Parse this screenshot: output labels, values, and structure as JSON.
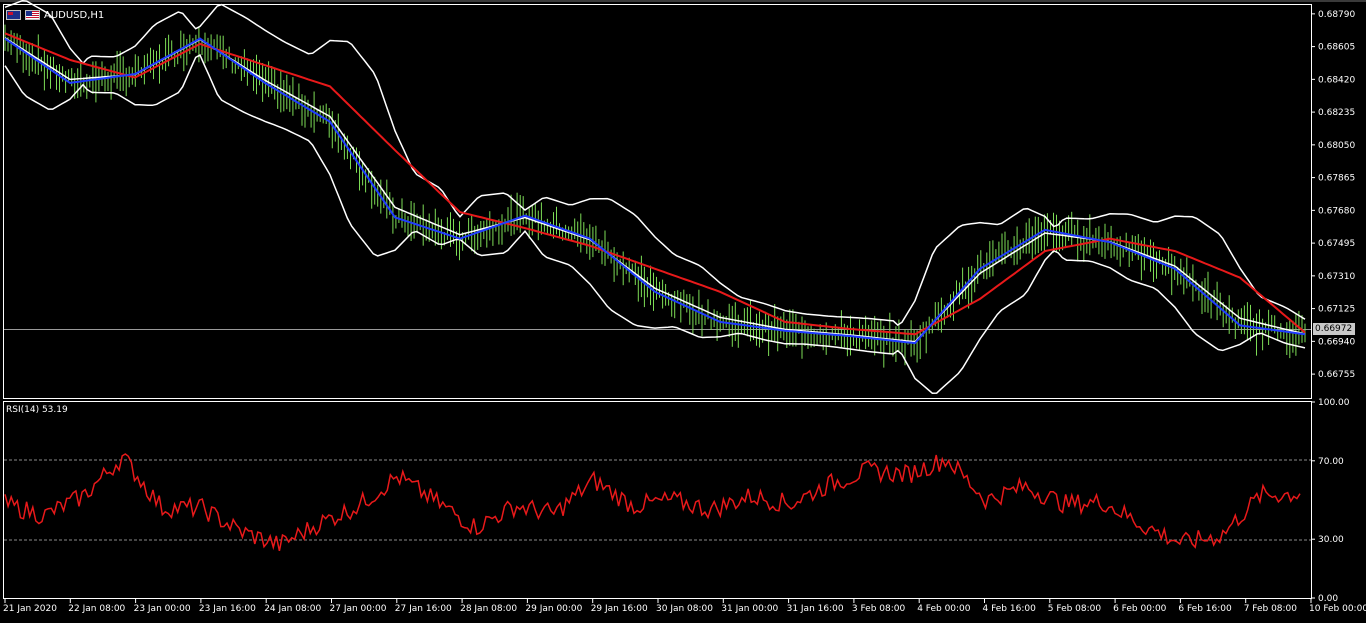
{
  "window": {
    "title": "AUDUSD,H1",
    "flag_left_icon": "au-flag-icon",
    "flag_right_icon": "us-flag-icon"
  },
  "colors": {
    "background": "#000000",
    "candle": "#7ddc56",
    "ma_fast": "#1f3cff",
    "ma_slow": "#e8191a",
    "bands": "#ffffff",
    "rsi_line": "#e8191a",
    "grid_level": "#8a8a8a",
    "price_line": "#9a9a9a",
    "price_tag_bg": "#c8c8c8"
  },
  "price_axis": {
    "labels": [
      "0.68790",
      "0.68605",
      "0.68420",
      "0.68235",
      "0.68050",
      "0.67865",
      "0.67680",
      "0.67495",
      "0.67310",
      "0.67125",
      "0.66940",
      "0.66755"
    ],
    "current_price": "0.66972"
  },
  "rsi_panel": {
    "label": "RSI(14) 53.19",
    "axis_labels": [
      "100.00",
      "70.00",
      "30.00",
      "0.00"
    ],
    "levels": [
      70,
      30
    ]
  },
  "time_axis": {
    "labels": [
      "21 Jan 2020",
      "22 Jan 08:00",
      "23 Jan 00:00",
      "23 Jan 16:00",
      "24 Jan 08:00",
      "27 Jan 00:00",
      "27 Jan 16:00",
      "28 Jan 08:00",
      "29 Jan 00:00",
      "29 Jan 16:00",
      "30 Jan 08:00",
      "31 Jan 00:00",
      "31 Jan 16:00",
      "3 Feb 08:00",
      "4 Feb 00:00",
      "4 Feb 16:00",
      "5 Feb 08:00",
      "6 Feb 00:00",
      "6 Feb 16:00",
      "7 Feb 08:00",
      "10 Feb 00:00"
    ]
  },
  "chart_data": [
    {
      "type": "line",
      "title": "AUDUSD,H1",
      "ylim": [
        0.6662,
        0.6884
      ],
      "x": [
        "21 Jan 2020",
        "22 Jan 08:00",
        "23 Jan 00:00",
        "23 Jan 16:00",
        "24 Jan 08:00",
        "27 Jan 00:00",
        "27 Jan 16:00",
        "28 Jan 08:00",
        "29 Jan 00:00",
        "29 Jan 16:00",
        "30 Jan 08:00",
        "31 Jan 00:00",
        "31 Jan 16:00",
        "3 Feb 08:00",
        "4 Feb 00:00",
        "4 Feb 16:00",
        "5 Feb 08:00",
        "6 Feb 00:00",
        "6 Feb 16:00",
        "7 Feb 08:00",
        "10 Feb 00:00"
      ],
      "series": [
        {
          "values": [
            0.6865,
            0.684,
            0.6845,
            0.6865,
            0.684,
            0.6818,
            0.6764,
            0.6752,
            0.6765,
            0.6752,
            0.6722,
            0.6705,
            0.67,
            0.6697,
            0.6693,
            0.6735,
            0.6757,
            0.675,
            0.6735,
            0.6703,
            0.6698
          ]
        },
        {
          "values": [
            0.6868,
            0.6853,
            0.6843,
            0.6862,
            0.685,
            0.6838,
            0.6802,
            0.6767,
            0.6758,
            0.6748,
            0.6735,
            0.6722,
            0.6705,
            0.6701,
            0.6698,
            0.6718,
            0.6745,
            0.6752,
            0.6745,
            0.673,
            0.6699
          ]
        }
      ]
    },
    {
      "type": "line",
      "title": "RSI(14) 53.19",
      "ylim": [
        0,
        100
      ],
      "x": [
        "21 Jan 2020",
        "22 Jan 08:00",
        "23 Jan 00:00",
        "23 Jan 16:00",
        "24 Jan 08:00",
        "27 Jan 00:00",
        "27 Jan 16:00",
        "28 Jan 08:00",
        "29 Jan 00:00",
        "29 Jan 16:00",
        "30 Jan 08:00",
        "31 Jan 00:00",
        "31 Jan 16:00",
        "3 Feb 08:00",
        "4 Feb 00:00",
        "4 Feb 16:00",
        "5 Feb 08:00",
        "6 Feb 00:00",
        "6 Feb 16:00",
        "7 Feb 08:00",
        "10 Feb 00:00"
      ],
      "series": [
        {
          "values": [
            48,
            42,
            52,
            72,
            46,
            46,
            34,
            27,
            38,
            47,
            62,
            49,
            36,
            47,
            43,
            60,
            47,
            50,
            45,
            52,
            48,
            58,
            65,
            63,
            71,
            50,
            57,
            48,
            49,
            37,
            28,
            32,
            52.5,
            53.19
          ]
        }
      ]
    }
  ]
}
